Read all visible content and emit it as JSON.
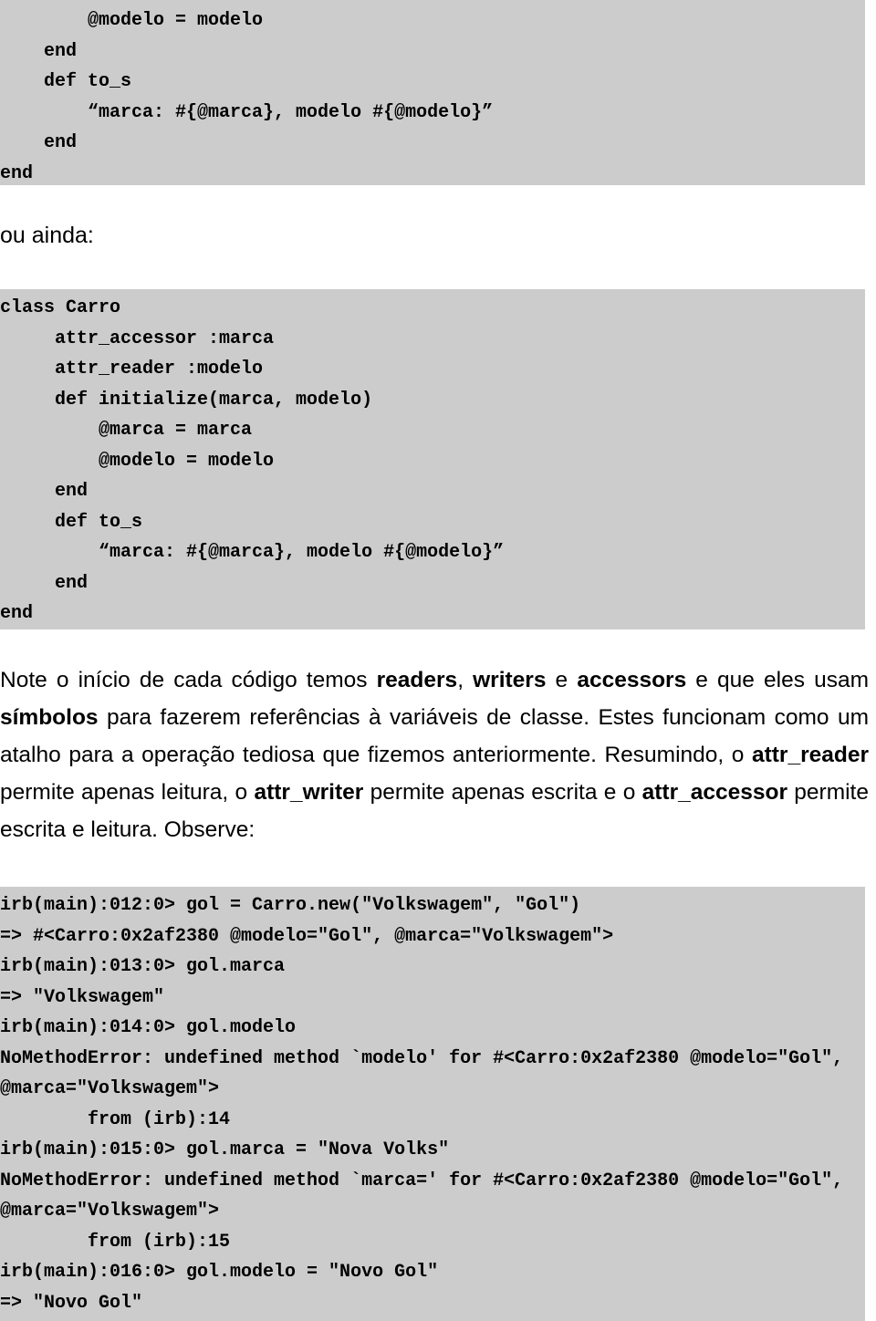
{
  "document": {
    "language": "pt-BR",
    "background_color": "#ffffff",
    "code_background_color": "#cccccc",
    "text_color": "#000000"
  },
  "code_block_1": {
    "name": "ruby-class-snippet-top",
    "lines": [
      "        @modelo = modelo",
      "    end",
      "    def to_s",
      "        “marca: #{@marca}, modelo #{@modelo}”",
      "    end",
      "end"
    ]
  },
  "ou_ainda": {
    "text": "ou ainda:"
  },
  "code_block_2": {
    "name": "ruby-class-carro-attr",
    "lines": [
      "class Carro",
      "     attr_accessor :marca",
      "     attr_reader :modelo",
      "     def initialize(marca, modelo)",
      "         @marca = marca",
      "         @modelo = modelo",
      "     end",
      "     def to_s",
      "         “marca: #{@marca}, modelo #{@modelo}”",
      "     end",
      "end"
    ]
  },
  "paragraph": {
    "segments": [
      {
        "text": "Note o início de cada código temos ",
        "bold": false
      },
      {
        "text": "readers",
        "bold": true
      },
      {
        "text": ", ",
        "bold": false
      },
      {
        "text": "writers",
        "bold": true
      },
      {
        "text": " e ",
        "bold": false
      },
      {
        "text": "accessors",
        "bold": true
      },
      {
        "text": " e que eles usam ",
        "bold": false
      },
      {
        "text": "símbolos",
        "bold": true
      },
      {
        "text": " para fazerem referências à variáveis de classe. Estes funcionam como um atalho para a operação tediosa que fizemos anteriormente. Resumindo, o ",
        "bold": false
      },
      {
        "text": "attr_reader",
        "bold": true
      },
      {
        "text": " permite apenas leitura, o ",
        "bold": false
      },
      {
        "text": "attr_writer",
        "bold": true
      },
      {
        "text": " permite apenas escrita e o ",
        "bold": false
      },
      {
        "text": "attr_accessor",
        "bold": true
      },
      {
        "text": " permite escrita e leitura. Observe:",
        "bold": false
      }
    ],
    "plain_text": "Note o início de cada código temos readers, writers e accessors e que eles usam símbolos para fazerem referências à variáveis de classe. Estes funcionam como um atalho para a operação tediosa que fizemos anteriormente. Resumindo, o attr_reader permite apenas leitura, o attr_writer permite apenas escrita e o attr_accessor permite escrita e leitura. Observe:"
  },
  "code_block_3": {
    "name": "irb-console-session",
    "lines": [
      "irb(main):012:0> gol = Carro.new(\"Volkswagem\", \"Gol\")",
      "=> #<Carro:0x2af2380 @modelo=\"Gol\", @marca=\"Volkswagem\">",
      "irb(main):013:0> gol.marca",
      "=> \"Volkswagem\"",
      "irb(main):014:0> gol.modelo",
      "NoMethodError: undefined method `modelo' for #<Carro:0x2af2380 @modelo=\"Gol\",",
      "@marca=\"Volkswagem\">",
      "        from (irb):14",
      "irb(main):015:0> gol.marca = \"Nova Volks\"",
      "NoMethodError: undefined method `marca=' for #<Carro:0x2af2380 @modelo=\"Gol\",",
      "@marca=\"Volkswagem\">",
      "        from (irb):15",
      "irb(main):016:0> gol.modelo = \"Novo Gol\"",
      "=> \"Novo Gol\""
    ]
  }
}
